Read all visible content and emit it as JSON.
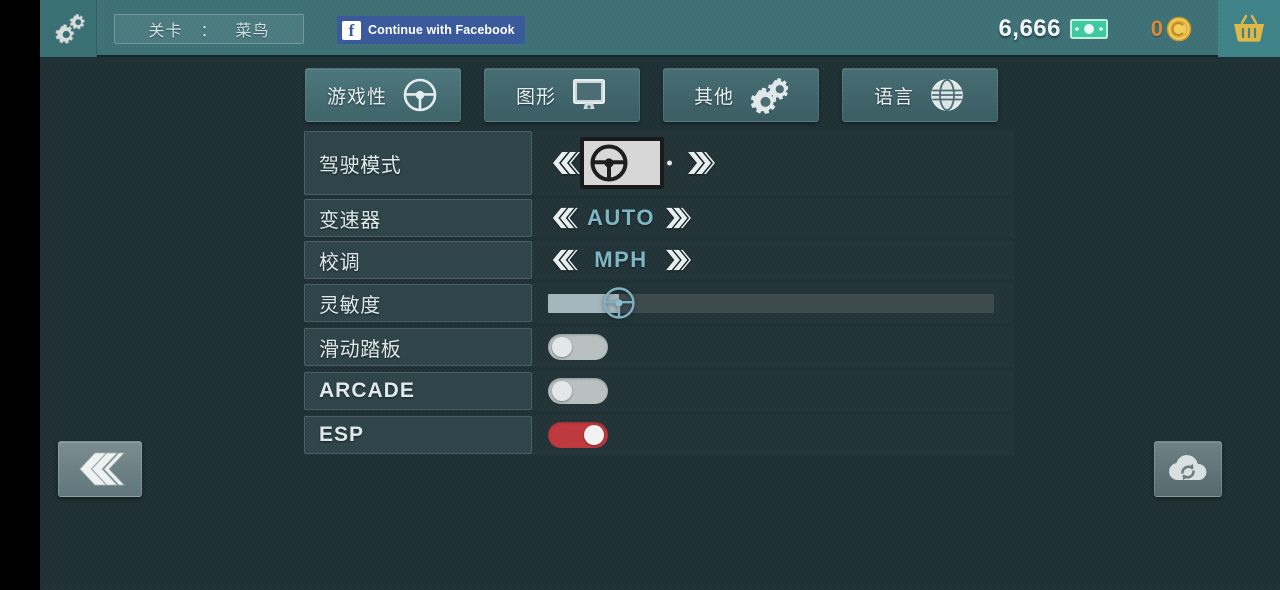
{
  "topbar": {
    "settings_gear_icon": "gears-icon",
    "level_label": "关卡",
    "level_separator": "：",
    "level_value": "菜鸟",
    "facebook_button_label": "Continue with Facebook",
    "facebook_glyph": "f",
    "money_value": "6,666",
    "money_icon": "banknote-icon",
    "coin_value": "0",
    "coin_icon": "gold-coin-icon",
    "shop_icon": "shopping-basket-icon"
  },
  "tabs": [
    {
      "label": "游戏性",
      "icon": "steering-wheel-icon",
      "active": true
    },
    {
      "label": "图形",
      "icon": "monitor-icon",
      "active": false
    },
    {
      "label": "其他",
      "icon": "gears-icon",
      "active": false
    },
    {
      "label": "语言",
      "icon": "globe-icon",
      "active": false
    }
  ],
  "settings": {
    "driving_mode": {
      "label": "驾驶模式",
      "type": "carousel",
      "prev_icon": "chevron-triple-left-icon",
      "next_icon": "chevron-triple-right-icon",
      "preview_icon": "steering-wheel-icon"
    },
    "transmission": {
      "label": "变速器",
      "type": "stepper",
      "value": "AUTO",
      "prev_icon": "chevron-triple-left-icon",
      "next_icon": "chevron-triple-right-icon"
    },
    "calibration": {
      "label": "校调",
      "type": "stepper",
      "value": "MPH",
      "prev_icon": "chevron-triple-left-icon",
      "next_icon": "chevron-triple-right-icon"
    },
    "sensitivity": {
      "label": "灵敏度",
      "type": "slider",
      "percent": 16,
      "knob_icon": "steering-wheel-icon"
    },
    "slide_pedal": {
      "label": "滑动踏板",
      "type": "toggle",
      "on": false
    },
    "arcade": {
      "label": "ARCADE",
      "type": "toggle",
      "on": false
    },
    "esp": {
      "label": "ESP",
      "type": "toggle",
      "on": true
    }
  },
  "footer": {
    "back_label": "back-button",
    "back_icon": "chevron-triple-left-icon",
    "cloud_label": "cloud-sync-button",
    "cloud_icon": "cloud-sync-icon"
  },
  "colors": {
    "background": "#1d2f33",
    "topbar": "#3c7075",
    "accent_value": "#7fb6c6",
    "toggle_on": "#bf3a3f",
    "toggle_off": "#b9c0c0",
    "coin": "#d98b3a",
    "facebook": "#3a5a9b"
  }
}
